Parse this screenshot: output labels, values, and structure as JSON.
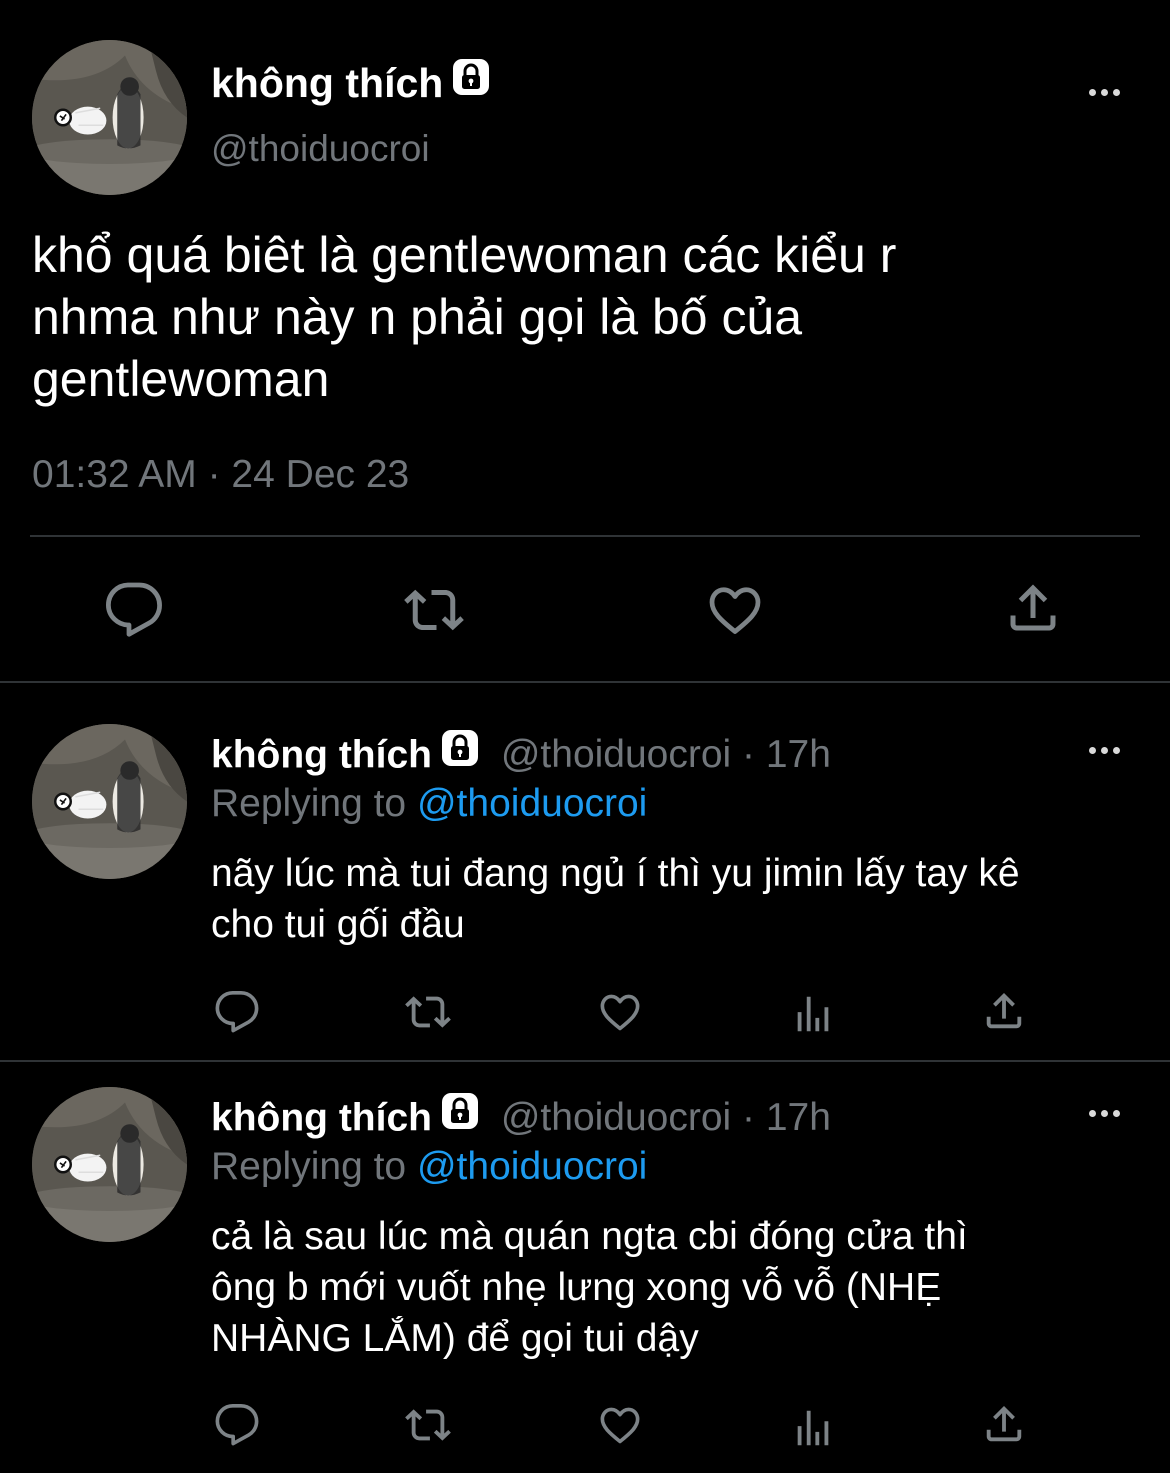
{
  "main_tweet": {
    "display_name": "không thích",
    "handle": "@thoiduocroi",
    "text_lines": [
      "khổ quá biêt là gentlewoman các kiểu r",
      "nhma như này n phải gọi là bố của",
      "gentlewoman"
    ],
    "timestamp": "01:32 AM · 24 Dec 23",
    "actions": [
      "reply-icon",
      "retweet-icon",
      "like-icon",
      "share-icon"
    ]
  },
  "replies": [
    {
      "display_name": "không thích",
      "handle_time": "@thoiduocroi · 17h",
      "replying_prefix": "Replying to",
      "replying_to": "@thoiduocroi",
      "text_lines": [
        "nãy lúc mà tui đang ngủ í thì yu jimin lấy tay kê",
        "cho tui gối đầu"
      ],
      "actions": [
        "reply-icon",
        "retweet-icon",
        "like-icon",
        "views-icon",
        "share-icon"
      ]
    },
    {
      "display_name": "không thích",
      "handle_time": "@thoiduocroi · 17h",
      "replying_prefix": "Replying to",
      "replying_to": "@thoiduocroi",
      "text_lines": [
        "cả là sau lúc mà quán ngta cbi đóng cửa thì",
        "ông b mới vuốt nhẹ lưng xong vỗ vỗ (NHẸ",
        "NHÀNG LẮM) để gọi tui dậy"
      ],
      "actions": [
        "reply-icon",
        "retweet-icon",
        "like-icon",
        "views-icon",
        "share-icon"
      ]
    }
  ],
  "colors": {
    "background": "#000000",
    "text": "#ffffff",
    "muted": "#71767b",
    "link": "#1d9bf0",
    "divider": "#2f3336"
  }
}
